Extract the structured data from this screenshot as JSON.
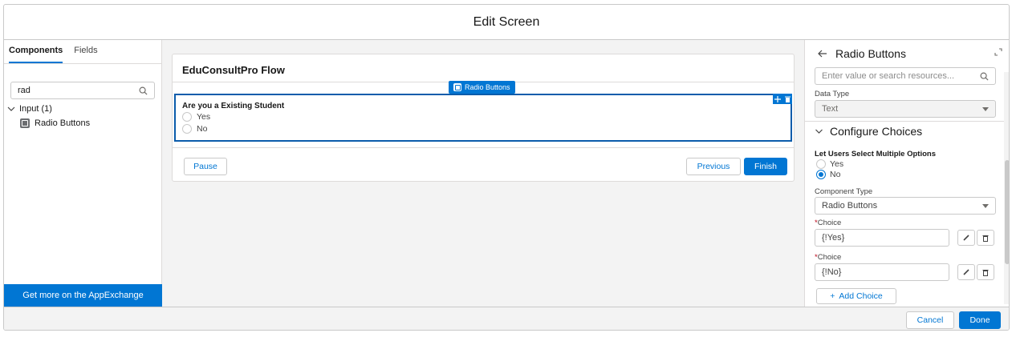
{
  "window": {
    "title": "Edit Screen"
  },
  "left_panel": {
    "tabs": [
      {
        "label": "Components",
        "active": true
      },
      {
        "label": "Fields",
        "active": false
      }
    ],
    "search": {
      "value": "rad"
    },
    "tree": {
      "group_label": "Input (1)",
      "item_label": "Radio Buttons"
    },
    "appexchange_label": "Get more on the AppExchange"
  },
  "canvas": {
    "flow_title": "EduConsultPro Flow",
    "component_tag": "Radio Buttons",
    "question": "Are you a Existing Student",
    "options": [
      "Yes",
      "No"
    ],
    "buttons": {
      "pause": "Pause",
      "previous": "Previous",
      "finish": "Finish"
    }
  },
  "right_panel": {
    "title": "Radio Buttons",
    "search_placeholder": "Enter value or search resources...",
    "data_type_label": "Data Type",
    "data_type_value": "Text",
    "section_title": "Configure Choices",
    "multi_select_label": "Let Users Select Multiple Options",
    "multi_select_options": [
      {
        "label": "Yes",
        "selected": false
      },
      {
        "label": "No",
        "selected": true
      }
    ],
    "component_type_label": "Component Type",
    "component_type_value": "Radio Buttons",
    "choices": [
      {
        "label": "Choice",
        "value": "{!Yes}"
      },
      {
        "label": "Choice",
        "value": "{!No}"
      }
    ],
    "required_marker": "*",
    "add_choice_label": "Add Choice"
  },
  "footer": {
    "cancel": "Cancel",
    "done": "Done"
  },
  "icons": {
    "search": "search-icon",
    "chevron_down": "chevron-down-icon",
    "back": "back-arrow-icon",
    "expand": "expand-icon",
    "edit": "pencil-icon",
    "delete": "trash-icon",
    "add": "plus-icon",
    "move": "move-icon"
  },
  "colors": {
    "brand": "#0176d3",
    "selection": "#0b5cab"
  }
}
